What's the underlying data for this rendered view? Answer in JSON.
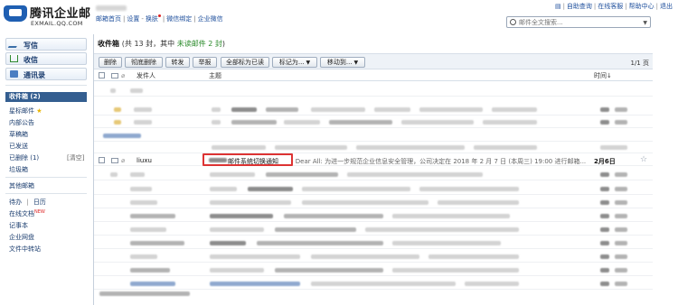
{
  "brand": {
    "name": "腾讯企业邮",
    "domain": "EXMAIL.QQ.COM"
  },
  "header": {
    "nav": {
      "home": "邮箱首页",
      "settings": "设置",
      "skin": "换肤",
      "wechat": "微信绑定",
      "enterprise": "企业微信"
    },
    "top_right": {
      "selfhelp": "自助查询",
      "support": "在线客服",
      "help": "帮助中心",
      "logout": "退出"
    },
    "search": {
      "placeholder": "邮件全文搜索..."
    }
  },
  "sidebar": {
    "write": "写信",
    "receive": "收信",
    "contacts": "通讯录",
    "inbox": "收件箱 (2)",
    "starred": "星标邮件",
    "internal": "内部公告",
    "drafts": "草稿箱",
    "sent": "已发送",
    "deleted": "已删除 (1)",
    "clear": "[清空]",
    "spam": "垃圾箱",
    "other": "其他邮箱",
    "todo": "待办",
    "calendar": "日历",
    "docs": "在线文档",
    "docs_badge": "NEW",
    "notes": "记事本",
    "drive": "企业网盘",
    "transfer": "文件中转站"
  },
  "main": {
    "title": "收件箱",
    "stat_prefix": "(共 13 封，其中 ",
    "unread": "未读邮件 2 封",
    "stat_suffix": ")",
    "toolbar": {
      "delete": "删除",
      "purge": "彻底删除",
      "forward": "转发",
      "report": "举报",
      "mark_all": "全部标为已读",
      "mark_as": "标记为...",
      "move_to": "移动到...",
      "page": "1/1 页"
    },
    "columns": {
      "from": "发件人",
      "subject": "主题",
      "time": "时间↓"
    },
    "highlighted_mail": {
      "from": "liuxu",
      "subject": "邮件系统切换通知",
      "preview": "- Dear All:  为进一步规范企业信息安全管理，公司决定在 2018 年 2 月 7 日 (本周三) 19:00 进行邮箱...",
      "time": "2月6日",
      "star": "☆"
    }
  }
}
